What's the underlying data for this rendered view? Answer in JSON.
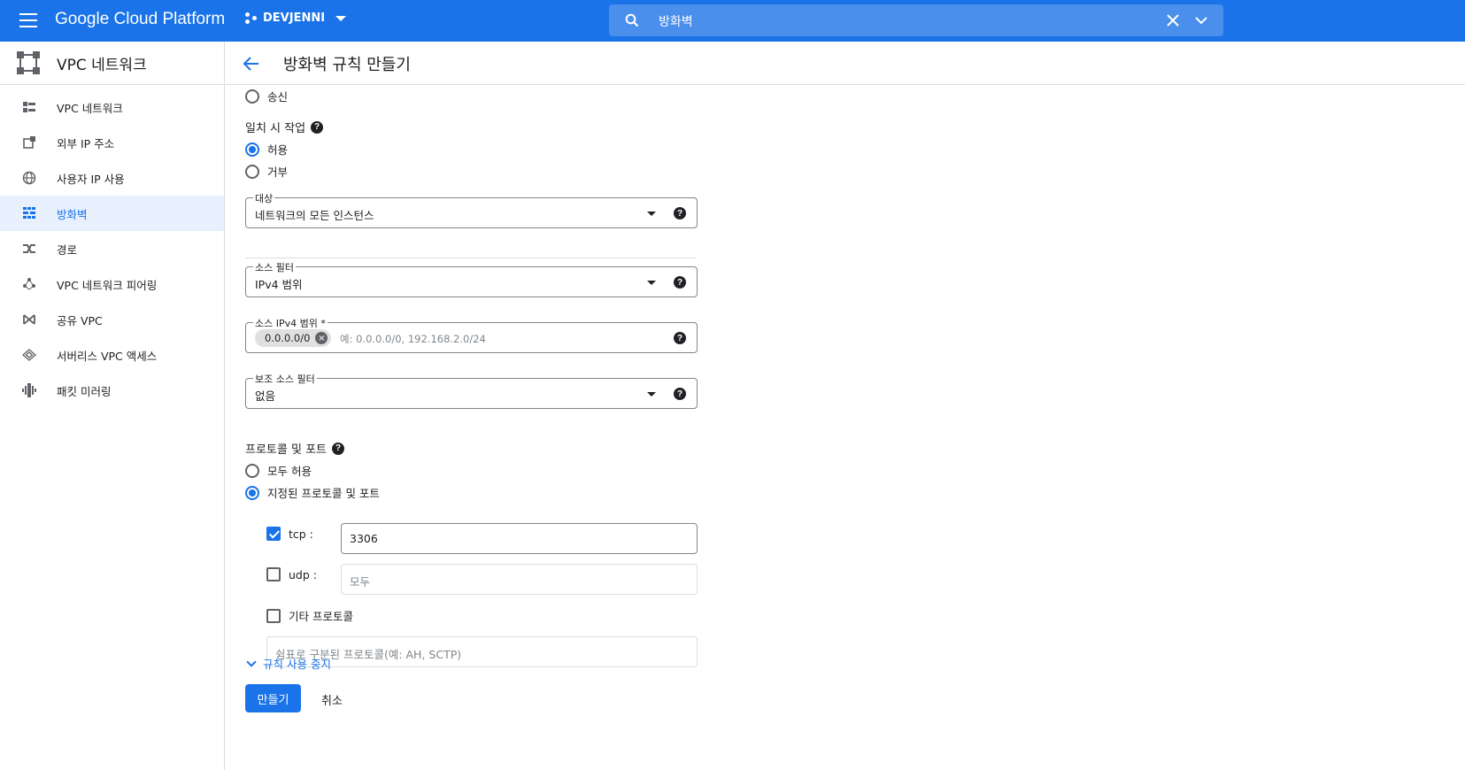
{
  "topbar": {
    "brand": "Google Cloud Platform",
    "project": "DEVJENNI",
    "search_value": "방화벽",
    "icons": [
      "menu-icon",
      "project-icon",
      "search-icon",
      "close-icon",
      "chevron-down-icon"
    ]
  },
  "sidebar": {
    "title": "VPC 네트워크",
    "items": [
      {
        "label": "VPC 네트워크",
        "icon": "vpc-network-icon",
        "active": false
      },
      {
        "label": "외부 IP 주소",
        "icon": "external-ip-icon",
        "active": false
      },
      {
        "label": "사용자 IP 사용",
        "icon": "globe-icon",
        "active": false
      },
      {
        "label": "방화벽",
        "icon": "firewall-icon",
        "active": true
      },
      {
        "label": "경로",
        "icon": "routes-icon",
        "active": false
      },
      {
        "label": "VPC 네트워크 피어링",
        "icon": "peering-icon",
        "active": false
      },
      {
        "label": "공유 VPC",
        "icon": "shared-vpc-icon",
        "active": false
      },
      {
        "label": "서버리스 VPC 액세스",
        "icon": "serverless-icon",
        "active": false
      },
      {
        "label": "패킷 미러링",
        "icon": "packet-mirroring-icon",
        "active": false
      }
    ]
  },
  "header": {
    "title": "방화벽 규칙 만들기"
  },
  "form": {
    "direction_egress_label": "송신",
    "action_label": "일치 시 작업",
    "action_allow": "허용",
    "action_deny": "거부",
    "targets": {
      "label": "대상",
      "value": "네트워크의 모든 인스턴스"
    },
    "source_filter": {
      "label": "소스 필터",
      "value": "IPv4 범위"
    },
    "source_ranges": {
      "label": "소스 IPv4 범위 *",
      "chip": "0.0.0.0/0",
      "placeholder": "예: 0.0.0.0/0, 192.168.2.0/24"
    },
    "secondary_filter": {
      "label": "보조 소스 필터",
      "value": "없음"
    },
    "protocols_label": "프로토콜 및 포트",
    "allow_all": "모두 허용",
    "specified": "지정된 프로토콜 및 포트",
    "tcp": {
      "label": "tcp :",
      "value": "3306",
      "checked": true
    },
    "udp": {
      "label": "udp :",
      "value": "모두",
      "checked": false
    },
    "other": {
      "label": "기타 프로토콜",
      "placeholder": "쉼표로 구분된 프로토콜(예: AH, SCTP)",
      "checked": false
    },
    "disable_rule_link": "규칙 사용 중지"
  },
  "actions": {
    "create": "만들기",
    "cancel": "취소"
  },
  "colors": {
    "brand": "#1a73e8",
    "search_bg": "#4a8fec",
    "active_nav_bg": "#e8f0fe"
  }
}
